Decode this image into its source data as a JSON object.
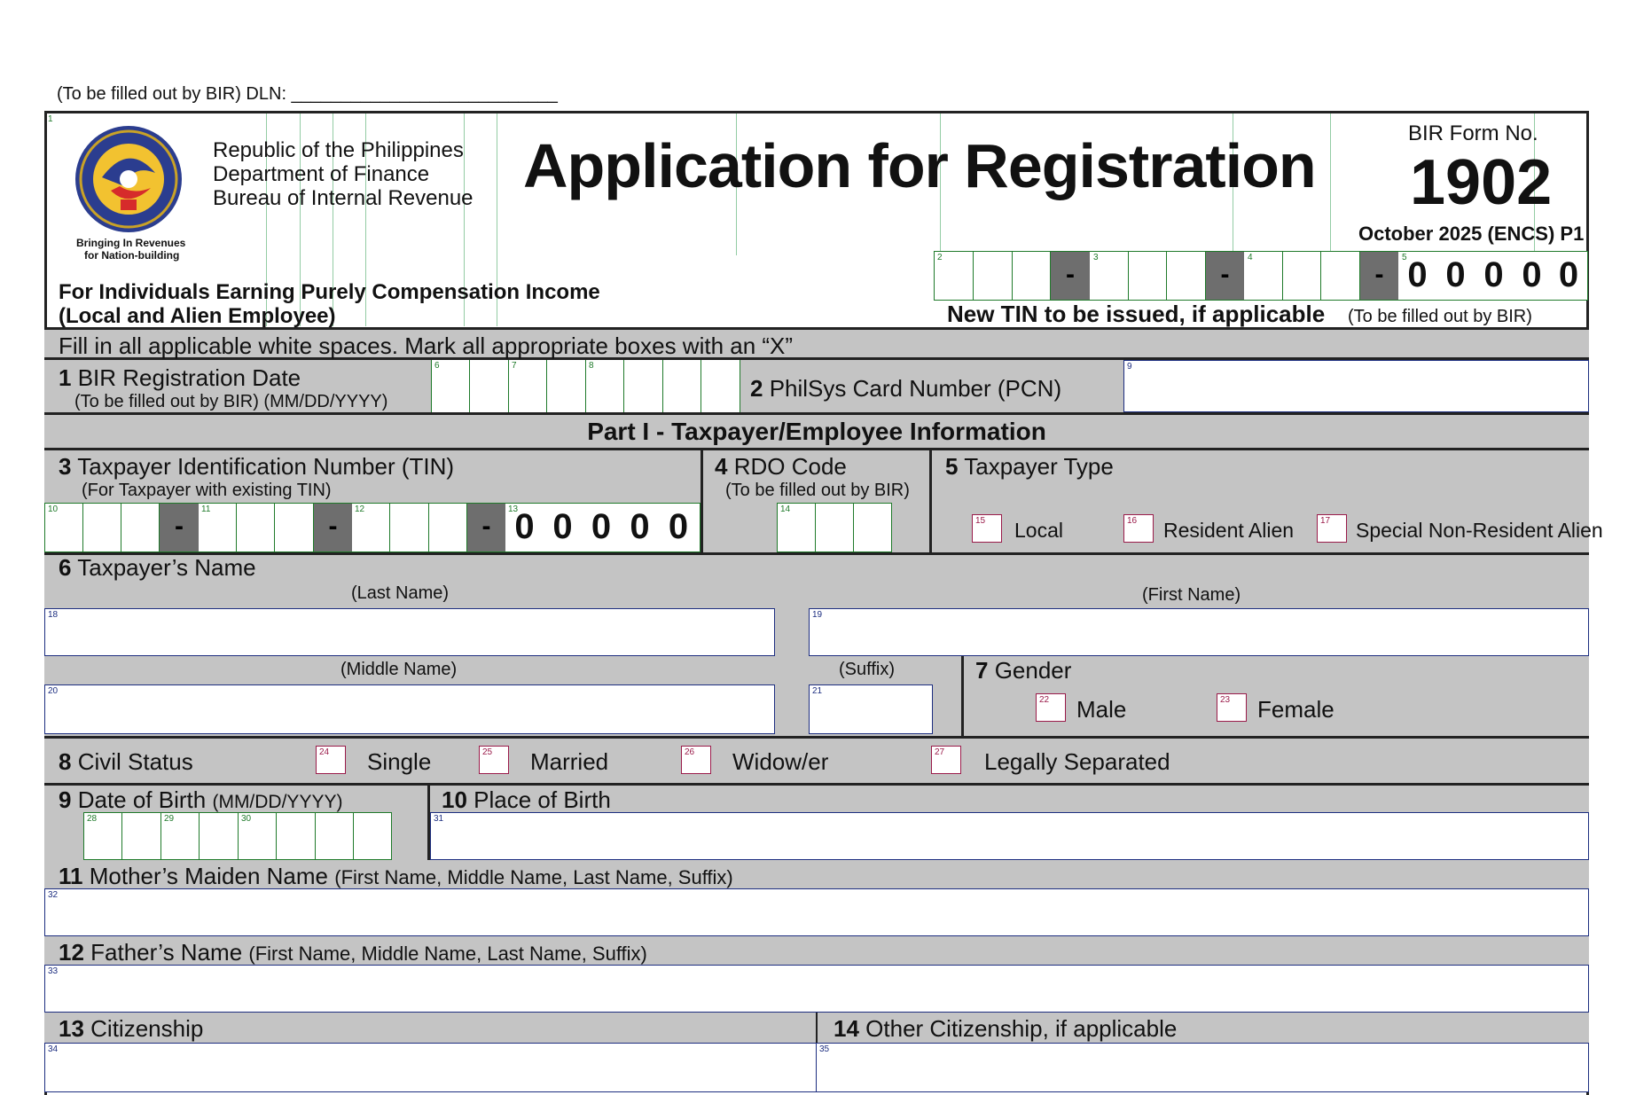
{
  "dln": {
    "label": "(To be filled out by BIR) DLN: ___________________________"
  },
  "header": {
    "agency_line1": "Republic of the Philippines",
    "agency_line2": "Department of Finance",
    "agency_line3": "Bureau of Internal Revenue",
    "logo_tagline1": "Bringing In Revenues",
    "logo_tagline2": "for Nation-building",
    "title": "Application for Registration",
    "form_label": "BIR Form No.",
    "form_number": "1902",
    "form_version": "October 2025 (ENCS) P1",
    "subtitle_line1": "For Individuals Earning Purely Compensation Income",
    "subtitle_line2": "(Local and Alien Employee)",
    "new_tin_label": "New TIN to be issued, if applicable",
    "new_tin_note": "(To be filled out by BIR)",
    "new_tin_digits": [
      "0",
      "0",
      "0",
      "0",
      "0"
    ]
  },
  "instructions": "Fill in all applicable white spaces. Mark all appropriate boxes with an “X”",
  "fields": {
    "reg_date": {
      "num": "1",
      "label": "BIR Registration Date",
      "sub": "(To be filled out by BIR) (MM/DD/YYYY)"
    },
    "pcn": {
      "num": "2",
      "label": "PhilSys Card Number (PCN)"
    },
    "part1_title": "Part I - Taxpayer/Employee Information",
    "tin": {
      "num": "3",
      "label": "Taxpayer Identification Number (TIN)",
      "sub": "(For Taxpayer with existing TIN)",
      "digits": [
        "0",
        "0",
        "0",
        "0",
        "0"
      ]
    },
    "rdo": {
      "num": "4",
      "label": "RDO Code",
      "sub": "(To be filled out by BIR)"
    },
    "taxpayer_type": {
      "num": "5",
      "label": "Taxpayer Type",
      "options": [
        "Local",
        "Resident Alien",
        "Special Non-Resident Alien"
      ]
    },
    "name": {
      "num": "6",
      "label": "Taxpayer’s Name",
      "last": "(Last Name)",
      "first": "(First Name)",
      "middle": "(Middle Name)",
      "suffix": "(Suffix)"
    },
    "gender": {
      "num": "7",
      "label": "Gender",
      "options": [
        "Male",
        "Female"
      ]
    },
    "civil_status": {
      "num": "8",
      "label": "Civil Status",
      "options": [
        "Single",
        "Married",
        "Widow/er",
        "Legally Separated"
      ]
    },
    "dob": {
      "num": "9",
      "label": "Date of Birth",
      "sub": "(MM/DD/YYYY)"
    },
    "pob": {
      "num": "10",
      "label": "Place of Birth"
    },
    "mother": {
      "num": "11",
      "label": "Mother’s Maiden Name",
      "sub": "(First Name, Middle Name, Last Name, Suffix)"
    },
    "father": {
      "num": "12",
      "label": "Father’s Name",
      "sub": "(First Name, Middle Name, Last Name, Suffix)"
    },
    "citizenship": {
      "num": "13",
      "label": "Citizenship"
    },
    "other_citizenship": {
      "num": "14",
      "label": "Other Citizenship, if applicable"
    }
  },
  "tiny": {
    "t1": "1",
    "t2": "2",
    "t3": "3",
    "t4": "4",
    "t5": "5",
    "t6": "6",
    "t7": "7",
    "t8": "8",
    "t9": "9",
    "t10": "10",
    "t11": "11",
    "t12": "12",
    "t13": "13",
    "t14": "14",
    "t15": "15",
    "t16": "16",
    "t17": "17",
    "t18": "18",
    "t19": "19",
    "t20": "20",
    "t21": "21",
    "t22": "22",
    "t23": "23",
    "t24": "24",
    "t25": "25",
    "t26": "26",
    "t27": "27",
    "t28": "28",
    "t29": "29",
    "t30": "30",
    "t31": "31",
    "t32": "32",
    "t33": "33",
    "t34": "34",
    "t35": "35"
  },
  "dash": "-"
}
